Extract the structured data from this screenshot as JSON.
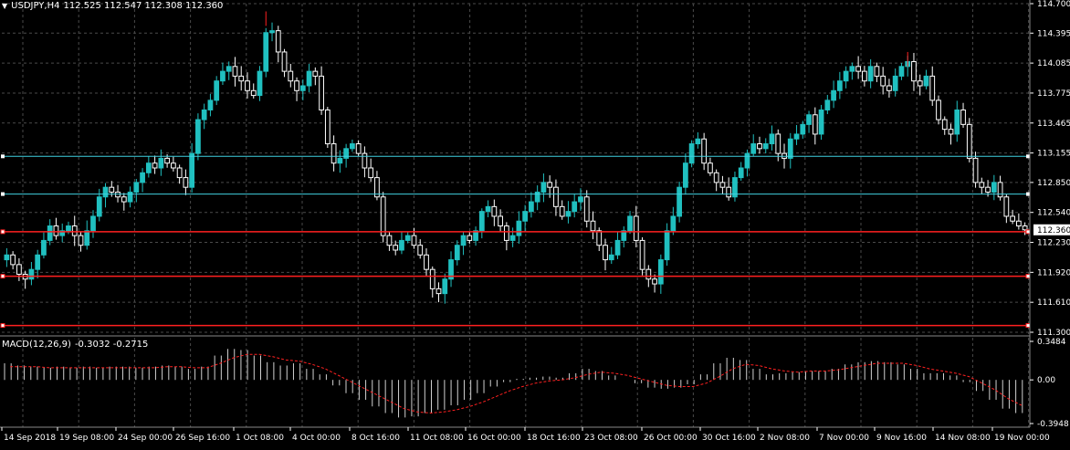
{
  "header": {
    "menu_glyph": "▼",
    "symbol": "USDJPY,H4",
    "ohlc": "112.525 112.547 112.308 112.360"
  },
  "macd_header": {
    "name": "MACD(12,26,9)",
    "values": "-0.3032 -0.2715"
  },
  "price_axis_labels": [
    "114.700",
    "114.395",
    "114.085",
    "113.775",
    "113.465",
    "113.155",
    "112.850",
    "112.540",
    "112.230",
    "111.920",
    "111.610",
    "111.300"
  ],
  "current_price_label": "112.360",
  "macd_axis_labels": [
    "0.3484",
    "0.00",
    "-0.3948"
  ],
  "time_axis_labels": [
    "14 Sep 2018",
    "19 Sep 08:00",
    "24 Sep 00:00",
    "26 Sep 16:00",
    "1 Oct 08:00",
    "4 Oct 00:00",
    "8 Oct 16:00",
    "11 Oct 08:00",
    "16 Oct 00:00",
    "18 Oct 16:00",
    "23 Oct 08:00",
    "26 Oct 00:00",
    "30 Oct 16:00",
    "2 Nov 08:00",
    "7 Nov 00:00",
    "9 Nov 16:00",
    "14 Nov 08:00",
    "19 Nov 00:00"
  ],
  "colors": {
    "background": "#000000",
    "grid": "#4a4a4a",
    "bull": "#20c0c0",
    "bear": "#ffffff",
    "extreme_wick": "#ff2020",
    "hline_cyan": "#40d0e0",
    "hline_red": "#ff2020",
    "macd_hist": "#d0d0d0",
    "macd_signal": "#ff2020",
    "axis_text": "#ffffff"
  },
  "chart_data": [
    {
      "type": "candlestick",
      "title": "USDJPY,H4",
      "ylim": [
        111.3,
        114.7
      ],
      "series": [
        {
          "values": [
            112.1,
            112.0,
            111.9,
            111.85,
            111.95,
            112.1,
            112.25,
            112.4,
            112.3,
            112.35,
            112.4,
            112.3,
            112.2,
            112.35,
            112.5,
            112.7,
            112.8,
            112.75,
            112.7,
            112.65,
            112.75,
            112.85,
            112.95,
            113.05,
            113.0,
            113.1,
            113.05,
            113.0,
            112.9,
            112.8,
            113.15,
            113.5,
            113.6,
            113.7,
            113.9,
            114.0,
            114.05,
            113.95,
            113.9,
            113.8,
            113.75,
            114.0,
            114.4,
            114.42,
            114.2,
            114.0,
            113.9,
            113.8,
            113.85,
            114.0,
            113.95,
            113.6,
            113.25,
            113.05,
            113.1,
            113.2,
            113.25,
            113.15,
            113.0,
            112.9,
            112.7,
            112.3,
            112.2,
            112.15,
            112.25,
            112.3,
            112.2,
            112.1,
            111.95,
            111.75,
            111.7,
            111.85,
            112.05,
            112.2,
            112.3,
            112.25,
            112.35,
            112.55,
            112.6,
            112.5,
            112.4,
            112.25,
            112.3,
            112.45,
            112.55,
            112.65,
            112.75,
            112.85,
            112.8,
            112.6,
            112.5,
            112.55,
            112.65,
            112.7,
            112.45,
            112.35,
            112.2,
            112.05,
            112.1,
            112.25,
            112.35,
            112.5,
            112.25,
            111.95,
            111.85,
            111.8,
            112.05,
            112.35,
            112.5,
            112.8,
            113.05,
            113.25,
            113.3,
            113.05,
            112.95,
            112.85,
            112.8,
            112.7,
            112.9,
            113.0,
            113.15,
            113.25,
            113.2,
            113.25,
            113.35,
            113.15,
            113.1,
            113.3,
            113.35,
            113.45,
            113.55,
            113.35,
            113.6,
            113.7,
            113.8,
            113.9,
            114.0,
            114.05,
            114.0,
            113.9,
            114.05,
            113.95,
            113.85,
            113.8,
            113.95,
            114.05,
            114.1,
            113.9,
            113.85,
            113.95,
            113.7,
            113.5,
            113.4,
            113.35,
            113.6,
            113.45,
            113.1,
            112.85,
            112.8,
            112.75,
            112.85,
            112.7,
            112.5,
            112.45,
            112.4,
            112.36
          ],
          "ohlc_example_last": [
            112.525,
            112.547,
            112.308,
            112.36
          ]
        }
      ],
      "highlight_levels": {
        "cyan": [
          113.12,
          112.73
        ],
        "red": [
          112.34,
          111.88,
          111.37
        ]
      }
    },
    {
      "type": "bar",
      "title": "MACD(12,26,9)",
      "ylim": [
        -0.3948,
        0.3484
      ],
      "series": [
        {
          "name": "MACD",
          "values": [
            0.15,
            0.13,
            0.12,
            0.11,
            0.12,
            0.11,
            0.12,
            0.11,
            0.12,
            0.12,
            0.11,
            0.12,
            0.13,
            0.12,
            0.1,
            0.12,
            0.22,
            0.28,
            0.27,
            0.22,
            0.16,
            0.13,
            0.15,
            0.1,
            0.05,
            -0.05,
            -0.12,
            -0.18,
            -0.24,
            -0.3,
            -0.34,
            -0.33,
            -0.3,
            -0.27,
            -0.23,
            -0.18,
            -0.12,
            -0.06,
            -0.02,
            0.01,
            0.02,
            0.03,
            0.02,
            0.06,
            0.1,
            0.08,
            0.04,
            0.0,
            -0.03,
            -0.07,
            -0.08,
            -0.07,
            -0.04,
            0.05,
            0.15,
            0.2,
            0.18,
            0.1,
            0.05,
            0.06,
            0.07,
            0.08,
            0.08,
            0.1,
            0.14,
            0.16,
            0.17,
            0.16,
            0.14,
            0.1,
            0.06,
            0.06,
            0.04,
            -0.02,
            -0.1,
            -0.18,
            -0.26,
            -0.3
          ]
        },
        {
          "name": "Signal",
          "values": [
            0.12,
            0.12,
            0.12,
            0.11,
            0.11,
            0.11,
            0.11,
            0.11,
            0.11,
            0.11,
            0.11,
            0.11,
            0.12,
            0.12,
            0.11,
            0.11,
            0.15,
            0.2,
            0.23,
            0.23,
            0.21,
            0.18,
            0.17,
            0.14,
            0.1,
            0.04,
            -0.02,
            -0.08,
            -0.14,
            -0.2,
            -0.26,
            -0.29,
            -0.3,
            -0.29,
            -0.27,
            -0.24,
            -0.2,
            -0.15,
            -0.1,
            -0.06,
            -0.03,
            -0.01,
            0.0,
            0.02,
            0.05,
            0.07,
            0.06,
            0.04,
            0.01,
            -0.02,
            -0.05,
            -0.06,
            -0.06,
            -0.03,
            0.03,
            0.1,
            0.14,
            0.13,
            0.1,
            0.08,
            0.07,
            0.08,
            0.08,
            0.09,
            0.11,
            0.13,
            0.15,
            0.15,
            0.15,
            0.13,
            0.1,
            0.08,
            0.06,
            0.03,
            -0.03,
            -0.09,
            -0.17,
            -0.23
          ]
        }
      ]
    }
  ]
}
